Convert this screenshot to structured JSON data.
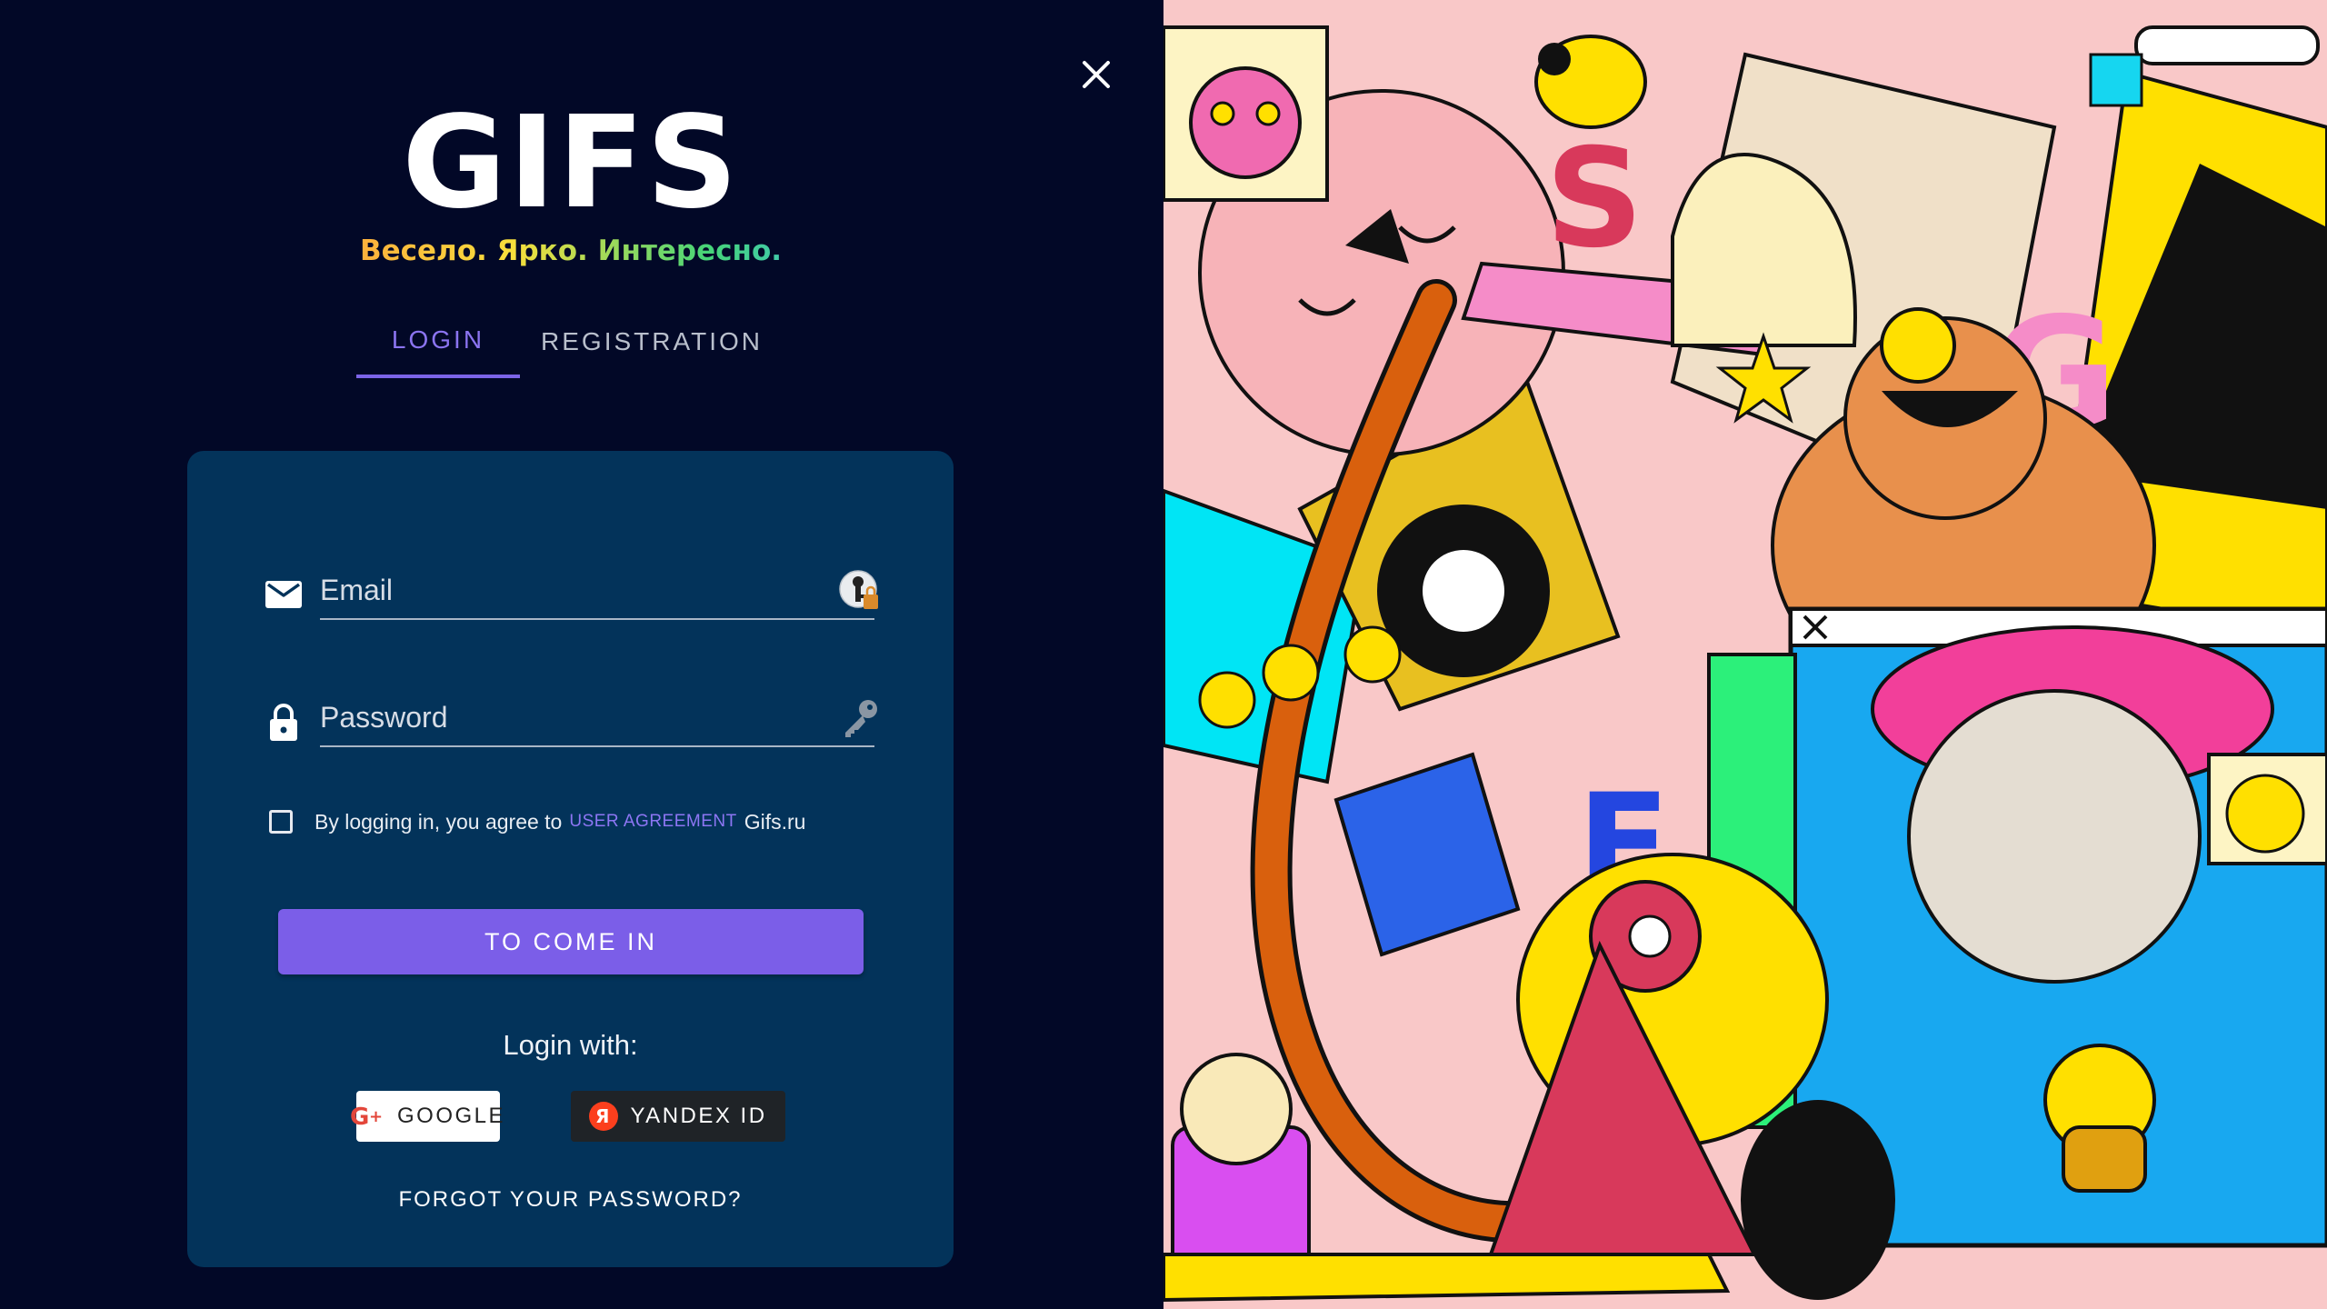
{
  "logo": {
    "word": "GIFS",
    "tagline": "Весело. Ярко. Интересно."
  },
  "tabs": [
    {
      "label": "LOGIN",
      "active": true
    },
    {
      "label": "REGISTRATION",
      "active": false
    }
  ],
  "form": {
    "email_placeholder": "Email",
    "password_placeholder": "Password",
    "agree_prefix": "By logging in, you agree to",
    "agree_link": "USER AGREEMENT",
    "agree_suffix": "Gifs.ru",
    "agree_checked": false,
    "submit_label": "TO COME IN"
  },
  "social": {
    "heading": "Login with:",
    "google_label": "GOOGLE",
    "yandex_label": "YANDEX ID"
  },
  "forgot_label": "FORGOT YOUR PASSWORD?",
  "illustration": {
    "letters": [
      "S",
      "G",
      "F"
    ]
  },
  "colors": {
    "background": "#020827",
    "card": "#03335a",
    "accent": "#7b5ee8",
    "illustration_bg": "#f9c8c8"
  },
  "icons": [
    "close-icon",
    "mail-icon",
    "lock-icon",
    "password-manager-icon",
    "key-icon",
    "google-plus-icon",
    "yandex-icon"
  ]
}
